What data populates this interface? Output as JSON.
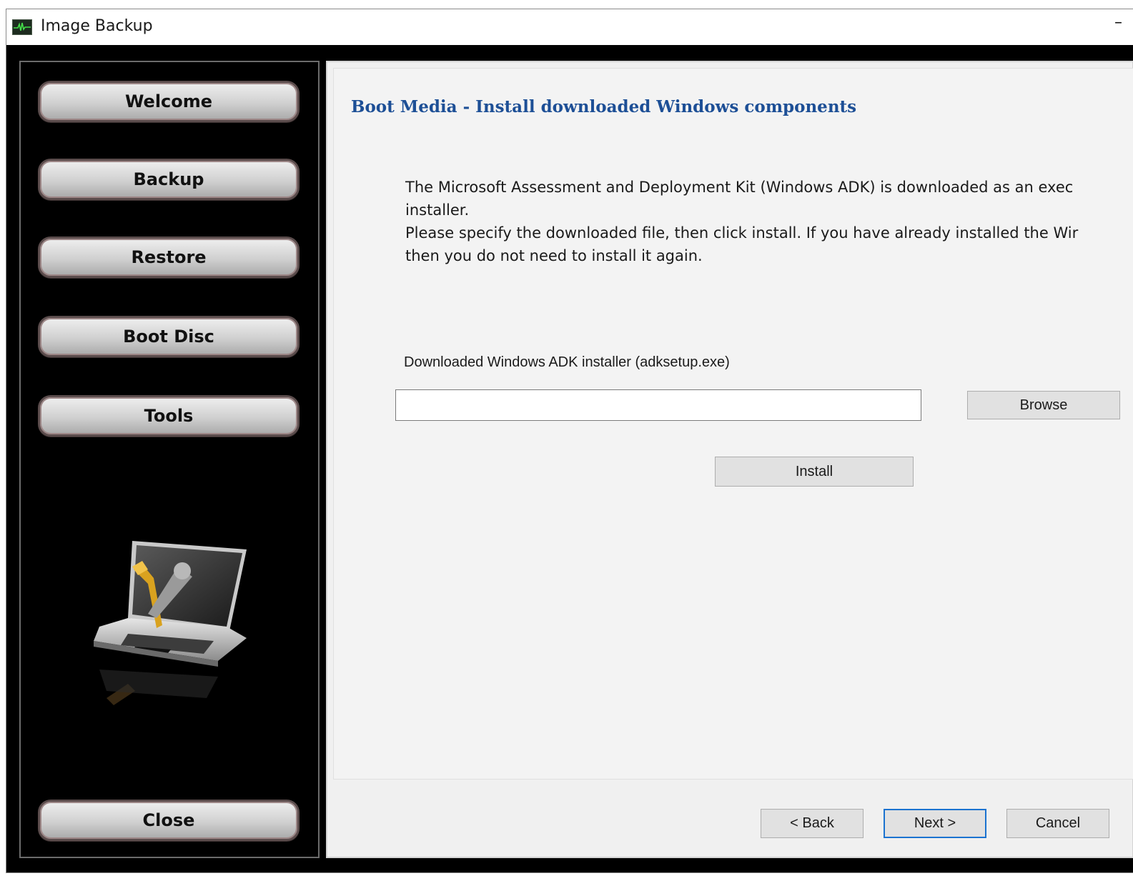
{
  "window": {
    "title": "Image Backup",
    "minimize_glyph": "–"
  },
  "sidebar": {
    "items": [
      {
        "label": "Welcome",
        "name": "sidebar-welcome-button"
      },
      {
        "label": "Backup",
        "name": "sidebar-backup-button"
      },
      {
        "label": "Restore",
        "name": "sidebar-restore-button"
      },
      {
        "label": "Boot Disc",
        "name": "sidebar-boot-disc-button"
      },
      {
        "label": "Tools",
        "name": "sidebar-tools-button"
      }
    ],
    "close_label": "Close",
    "illustration": "laptop-with-tools-icon"
  },
  "main": {
    "title": "Boot Media - Install downloaded Windows components",
    "description_lines": [
      "The Microsoft Assessment and Deployment Kit (Windows ADK) is downloaded as an exec",
      "installer.",
      "Please specify the downloaded file, then click install. If you have already installed the Wir",
      "then you do not need to install it again."
    ],
    "field_label": "Downloaded Windows ADK installer (adksetup.exe)",
    "path_value": "",
    "browse_label": "Browse",
    "install_label": "Install"
  },
  "footer": {
    "back_label": "< Back",
    "next_label": "Next >",
    "cancel_label": "Cancel"
  },
  "colors": {
    "title_blue": "#1d4f96",
    "sidebar_bg": "#000000",
    "panel_bg": "#f0f0f0",
    "focus_border": "#1b73d0"
  }
}
